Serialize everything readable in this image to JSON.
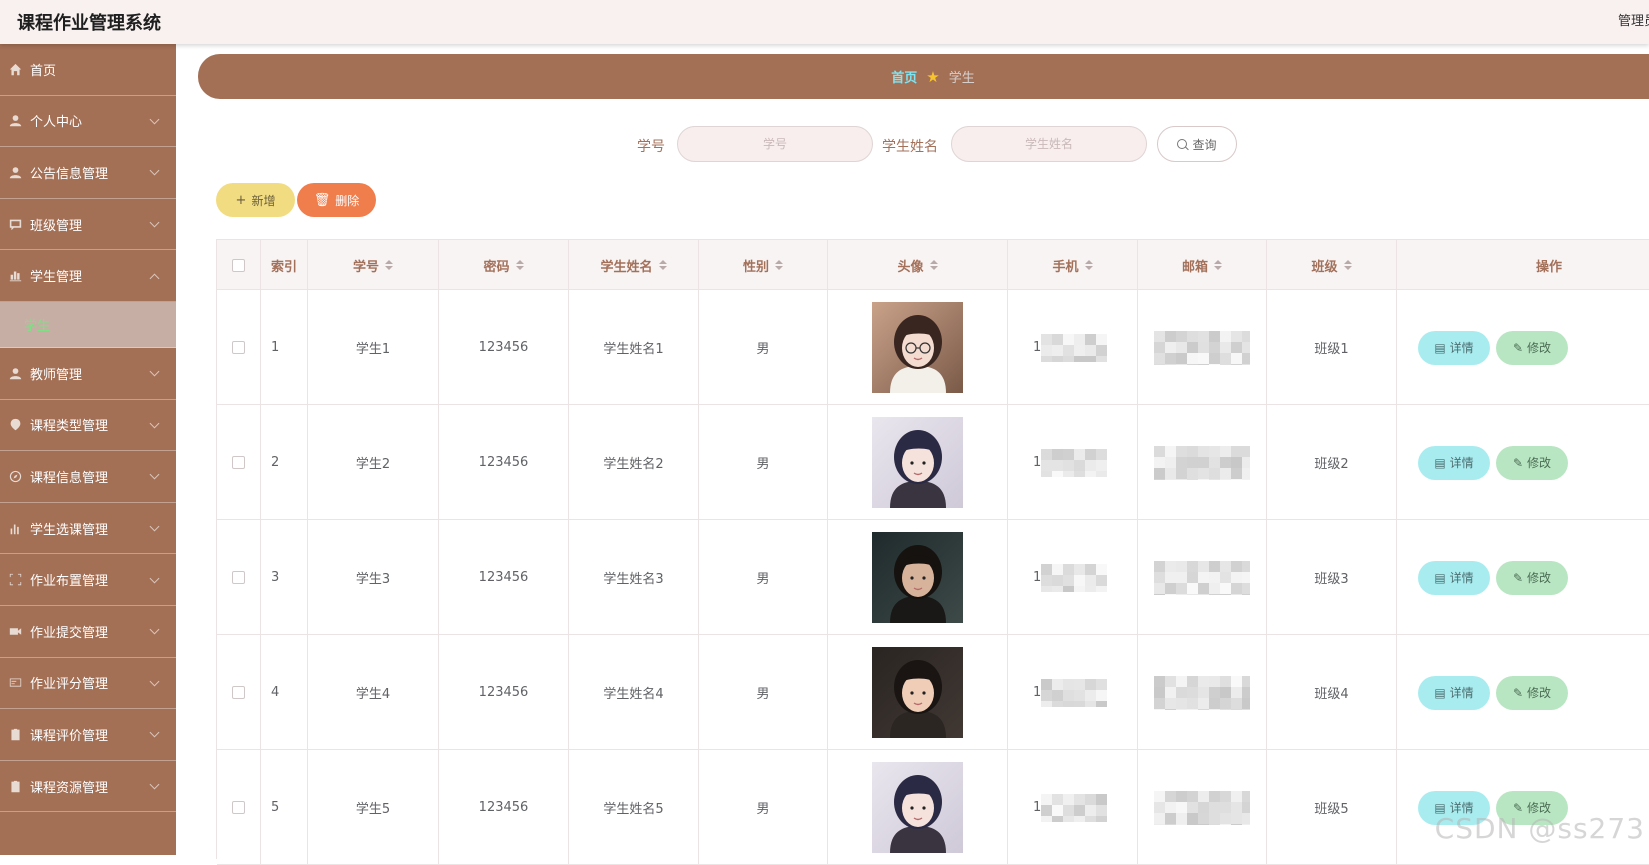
{
  "app": {
    "title": "课程作业管理系统",
    "user": "管理员"
  },
  "sidebar": {
    "items": [
      {
        "label": "首页",
        "icon": "home-icon",
        "expandable": false
      },
      {
        "label": "个人中心",
        "icon": "user-icon",
        "expandable": true
      },
      {
        "label": "公告信息管理",
        "icon": "user-icon",
        "expandable": true
      },
      {
        "label": "班级管理",
        "icon": "chat-icon",
        "expandable": true
      },
      {
        "label": "学生管理",
        "icon": "chart-icon",
        "expandable": true,
        "open": true,
        "children": [
          "学生"
        ]
      },
      {
        "label": "教师管理",
        "icon": "user-icon",
        "expandable": true
      },
      {
        "label": "课程类型管理",
        "icon": "location-icon",
        "expandable": true
      },
      {
        "label": "课程信息管理",
        "icon": "compass-icon",
        "expandable": true
      },
      {
        "label": "学生选课管理",
        "icon": "bar-chart-icon",
        "expandable": true
      },
      {
        "label": "作业布置管理",
        "icon": "fullscreen-icon",
        "expandable": true
      },
      {
        "label": "作业提交管理",
        "icon": "video-icon",
        "expandable": true
      },
      {
        "label": "作业评分管理",
        "icon": "card-icon",
        "expandable": true
      },
      {
        "label": "课程评价管理",
        "icon": "clipboard-icon",
        "expandable": true
      },
      {
        "label": "课程资源管理",
        "icon": "clipboard-icon",
        "expandable": true
      }
    ]
  },
  "breadcrumb": {
    "home": "首页",
    "current": "学生"
  },
  "search": {
    "id_label": "学号",
    "id_placeholder": "学号",
    "name_label": "学生姓名",
    "name_placeholder": "学生姓名",
    "query_label": "查询"
  },
  "actions": {
    "add": "新增",
    "delete": "删除"
  },
  "table": {
    "columns": [
      "索引",
      "学号",
      "密码",
      "学生姓名",
      "性别",
      "头像",
      "手机",
      "邮箱",
      "班级",
      "操作"
    ],
    "detail_label": "详情",
    "edit_label": "修改",
    "rows": [
      {
        "index": "1",
        "id": "学生1",
        "password": "123456",
        "name": "学生姓名1",
        "gender": "男",
        "phone_prefix": "1",
        "class": "班级1"
      },
      {
        "index": "2",
        "id": "学生2",
        "password": "123456",
        "name": "学生姓名2",
        "gender": "男",
        "phone_prefix": "1",
        "class": "班级2"
      },
      {
        "index": "3",
        "id": "学生3",
        "password": "123456",
        "name": "学生姓名3",
        "gender": "男",
        "phone_prefix": "1",
        "class": "班级3"
      },
      {
        "index": "4",
        "id": "学生4",
        "password": "123456",
        "name": "学生姓名4",
        "gender": "男",
        "phone_prefix": "1",
        "class": "班级4"
      },
      {
        "index": "5",
        "id": "学生5",
        "password": "123456",
        "name": "学生姓名5",
        "gender": "男",
        "phone_prefix": "1",
        "class": "班级5"
      }
    ]
  },
  "watermark": "CSDN @ss273",
  "colors": {
    "sidebar": "#a36f55",
    "accent": "#a3705a",
    "active_sub": "#7ee084"
  }
}
